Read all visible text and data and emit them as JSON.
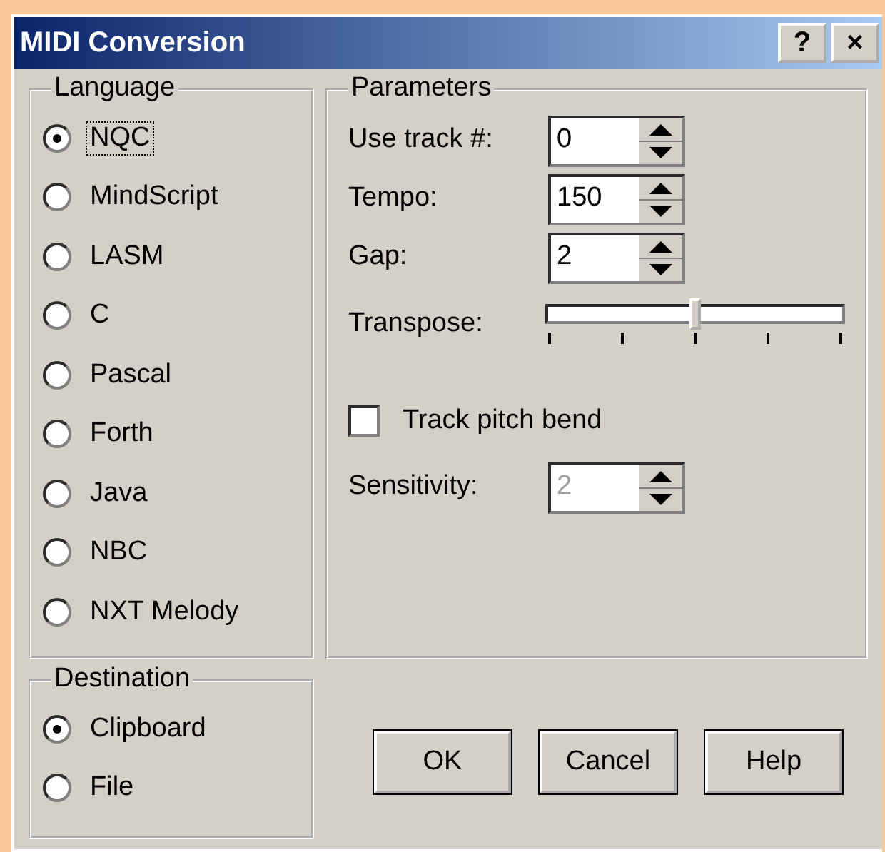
{
  "window": {
    "title": "MIDI Conversion",
    "title_buttons": [
      "?",
      "×"
    ]
  },
  "language": {
    "title": "Language",
    "options": [
      {
        "label": "NQC",
        "selected": true,
        "focused": true
      },
      {
        "label": "MindScript",
        "selected": false,
        "focused": false
      },
      {
        "label": "LASM",
        "selected": false,
        "focused": false
      },
      {
        "label": "C",
        "selected": false,
        "focused": false
      },
      {
        "label": "Pascal",
        "selected": false,
        "focused": false
      },
      {
        "label": "Forth",
        "selected": false,
        "focused": false
      },
      {
        "label": "Java",
        "selected": false,
        "focused": false
      },
      {
        "label": "NBC",
        "selected": false,
        "focused": false
      },
      {
        "label": "NXT Melody",
        "selected": false,
        "focused": false
      }
    ]
  },
  "destination": {
    "title": "Destination",
    "options": [
      {
        "label": "Clipboard",
        "selected": true
      },
      {
        "label": "File",
        "selected": false
      }
    ]
  },
  "parameters": {
    "title": "Parameters",
    "rows": [
      {
        "kind": "spinner",
        "label": "Use track #:",
        "value": "0",
        "disabled": false
      },
      {
        "kind": "spinner",
        "label": "Tempo:",
        "value": "150",
        "disabled": false
      },
      {
        "kind": "spinner",
        "label": "Gap:",
        "value": "2",
        "disabled": false
      },
      {
        "kind": "slider",
        "label": "Transpose:",
        "level": 0.5
      },
      {
        "kind": "checkbox",
        "label": "Track pitch bend",
        "checked": false
      },
      {
        "kind": "spinner",
        "label": "Sensitivity:",
        "value": "2",
        "disabled": true
      }
    ]
  },
  "buttons": [
    "OK",
    "Cancel",
    "Help"
  ]
}
